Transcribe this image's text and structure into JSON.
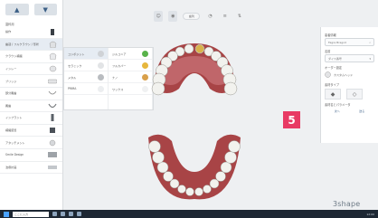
{
  "left_panel": {
    "title": "歯科用",
    "rows": [
      {
        "label": "操作",
        "icon": "tooth-icon"
      },
      {
        "label": "歯冠 / フルクラウン / 形状",
        "icon": "crown-icon"
      },
      {
        "label": "クラウン補綴",
        "icon": "crown-icon"
      },
      {
        "label": "インレー",
        "icon": "inlay-icon"
      },
      {
        "label": "ブリッジ",
        "icon": "bridge-icon"
      },
      {
        "label": "部分義歯",
        "icon": "partial-icon"
      },
      {
        "label": "義歯",
        "icon": "denture-icon"
      },
      {
        "label": "インプラント",
        "icon": "implant-icon"
      },
      {
        "label": "補綴装置",
        "icon": "prosthesis-icon"
      },
      {
        "label": "アタッチメント",
        "icon": "attachment-icon"
      },
      {
        "label": "Smile Design",
        "icon": "smile-icon"
      },
      {
        "label": "治療計画",
        "icon": "plan-icon"
      }
    ]
  },
  "submenu": {
    "col1": [
      {
        "label": "コンポジット"
      },
      {
        "label": "セラミック"
      },
      {
        "label": "メタル"
      },
      {
        "label": "PMMA"
      }
    ],
    "col2": [
      {
        "label": "ジルコニア"
      },
      {
        "label": "フルカバー"
      },
      {
        "label": "ナノ"
      },
      {
        "label": "ワックス"
      }
    ]
  },
  "toolbar": {
    "pill_label": "歯列",
    "buttons": [
      "A",
      "B",
      "C",
      "D"
    ]
  },
  "step_badge": "5",
  "right_panel": {
    "section1": "患者情報",
    "field1": "Fagre Bragod",
    "section2": "名前",
    "field2": "ダイス番号",
    "section3": "オーダー設定",
    "tile_label": "カスタムヘッド",
    "section4": "素材タイプ",
    "section5": "素材名とパラメータ",
    "bottom_labels": [
      "次へ",
      "送る"
    ]
  },
  "brand": {
    "text": "3shape",
    "accent": "#e7412a"
  },
  "taskbar": {
    "search_placeholder": "ここに入力",
    "tray": "12:00"
  },
  "colors": {
    "badge": "#e83a64",
    "gum": "#a84446",
    "tooth": "#f2f2ee"
  }
}
